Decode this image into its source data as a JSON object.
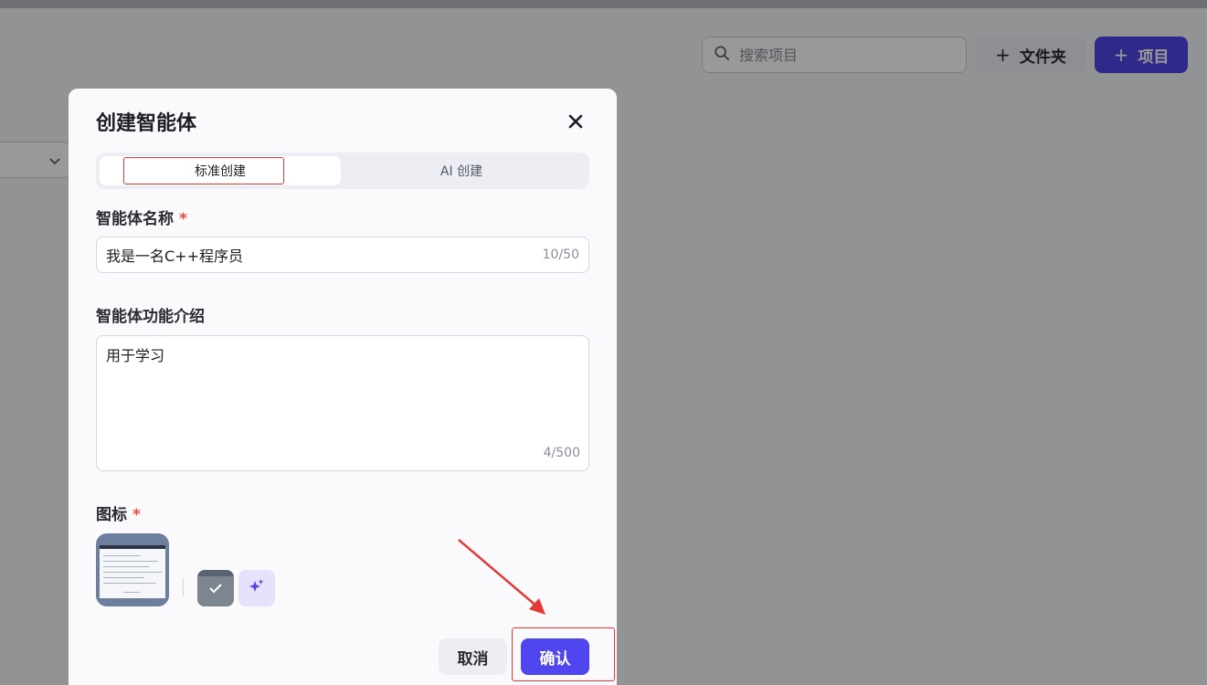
{
  "background": {
    "search": {
      "placeholder": "搜索项目",
      "icon": "search-icon"
    },
    "folder_button": {
      "label": "文件夹",
      "icon": "plus-icon"
    },
    "project_button": {
      "label": "项目",
      "icon": "plus-icon"
    },
    "select": {
      "icon": "chevron-down-icon"
    }
  },
  "dialog": {
    "title": "创建智能体",
    "close_icon": "close-icon",
    "tabs": [
      {
        "label": "标准创建",
        "active": true
      },
      {
        "label": "AI 创建",
        "active": false
      }
    ],
    "name_field": {
      "label": "智能体名称",
      "required_mark": "*",
      "value": "我是一名C++程序员",
      "counter": "10/50"
    },
    "desc_field": {
      "label": "智能体功能介绍",
      "value": "用于学习",
      "counter": "4/500"
    },
    "icon_field": {
      "label": "图标",
      "required_mark": "*"
    },
    "cancel_label": "取消",
    "confirm_label": "确认"
  },
  "colors": {
    "accent": "#4f46e5",
    "annotation_red": "#e53935",
    "required_red": "#e84c3d"
  }
}
